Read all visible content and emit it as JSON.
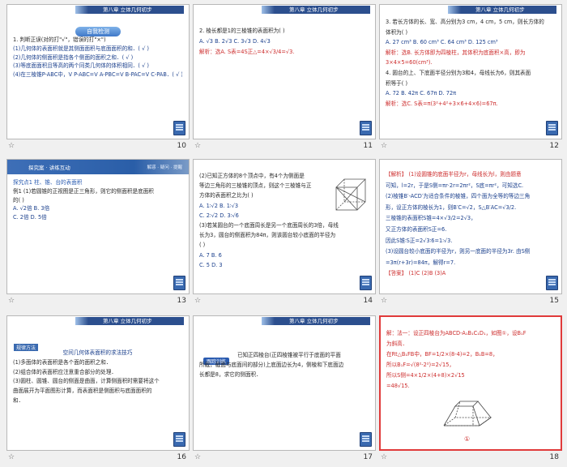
{
  "header_label": "第八章 立体几何初步",
  "slides": [
    {
      "number": "10",
      "title": "自我检测",
      "lines": [
        "1. 判断正误(对的打\"√\"，错误的打\"×\")",
        "(1)几何体的表面积就是其侧面面积与底面面积的和．( √ )",
        "(2)几何体的侧面积是指各个侧面的面积之和．( √ )",
        "(3)等底面面积且等高的两个同类几何体的体积相同．( √ )",
        "(4)在三棱锥P-ABC中，V P-ABC=V A-PBC=V B-PAC=V C-PAB．( √ )"
      ]
    },
    {
      "number": "11",
      "lines": [
        "2. 棱长都是1的三棱锥的表面积为(    )",
        "A. √3        B. 2√3        C. 3√3        D. 4√3",
        "解析：选A. S表=4S正△=4×√3/4=√3."
      ]
    },
    {
      "number": "12",
      "lines": [
        "3. 若长方体的长、宽、高分别为3 cm，4 cm，5 cm，则长方体的",
        "体积为(    )",
        "A. 27 cm³     B. 60 cm³     C. 64 cm³     D. 125 cm³",
        "解析：选B. 长方体即为四棱柱，其体积为底面积×高，即为",
        "3×4×5=60(cm³).",
        "4. 圆台的上、下底面半径分别为3和4，母线长为6，则其表面",
        "积等于(    )",
        "A. 72        B. 42π        C. 67π        D. 72π",
        "解析：选C. S表=π(3²+4²+3×6+4×6)=67π."
      ]
    },
    {
      "number": "13",
      "bar_title": "探究案 · 讲练互动",
      "bar_right": "解惑 · 疑问 · 提醒",
      "section": "探究点1  柱、锥、台的表面积",
      "lines": [
        "例1 (1)若圆锥的正视图是正三角形，则它的侧面积是底面积",
        "的(    )",
        "A. √2倍              B. 3倍",
        "C. 2倍               D. 5倍"
      ]
    },
    {
      "number": "14",
      "lines": [
        "(2)已知正方体的8个顶点中，有4个为侧面是",
        "等边三角形的三棱锥的顶点，则这个三棱锥与正",
        "方体的表面积之比为(    )",
        "A. 1∶√2             B. 1∶√3",
        "C. 2∶√2             D. 3∶√6",
        "(3)若某圆台的一个底面周长是另一个底面周长的3倍，母线",
        "长为3，圆台的侧面积为84π，则该圆台较小底面的半径为",
        "(    )",
        "A. 7                 B. 6",
        "C. 5                 D. 3"
      ]
    },
    {
      "number": "15",
      "lines": [
        "【解析】 (1)设圆锥的底面半径为r，母线长为l，则由题意",
        "可知，l=2r，于是S侧=πr·2r=2πr²，S底=πr²，可知选C.",
        "(2)棱锥B′-ACD′为适合条件的棱锥，四个面为全等的等边三角",
        "形，设正方体的棱长为1，则B′C=√2，S△B′AC=√3/2.",
        "三棱锥的表面积S锥=4×√3/2=2√3，",
        "又正方体的表面积S正=6.",
        "因此S锥∶S正=2√3∶6=1∶√3.",
        "(3)设圆台较小底面的半径为r，则另一底面的半径为3r. 由S侧",
        "=3π(r+3r)=84π，解得r=7.",
        "【答案】 (1)C   (2)B   (3)A"
      ]
    },
    {
      "number": "16",
      "title_box": "规律方法",
      "heading": "空间几何体表面积的求法技巧",
      "lines": [
        "(1)多面体的表面积是各个面的面积之和．",
        "(2)组合体的表面积应注意重合部分的处理．",
        "(3)圆柱、圆锥、圆台的侧面是曲面，计算侧面积时需要将这个",
        "曲面展开为平面图形计算，而表面积是侧面积与底面面积的",
        "和．"
      ]
    },
    {
      "number": "17",
      "tag": "跟踪训练",
      "lines": [
        "已知正四棱台(正四棱锥被平行于底面的平面",
        "所截，截面与底面间的部分)上底面边长为4，侧棱和下底面边",
        "长都是8，求它的侧面积．"
      ]
    },
    {
      "number": "18",
      "lines": [
        "解：法一：设正四棱台为ABCD-A₁B₁C₁D₁，如图①，设B₁F",
        "为斜高．",
        "在Rt△B₁FB中，BF=1/2×(8-4)=2，B₁B=8，",
        "所以B₁F=√(8²-2²)=2√15，",
        "所以S侧=4×1/2×(4+8)×2√15",
        "=48√15."
      ],
      "figure_label": "①"
    }
  ]
}
